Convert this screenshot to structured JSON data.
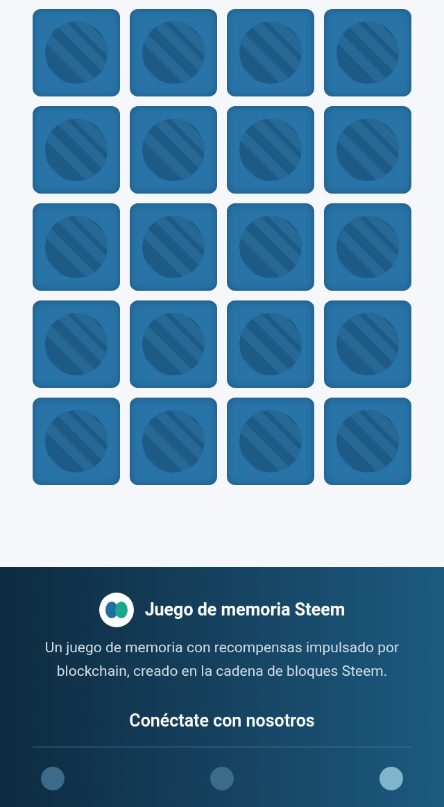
{
  "cards": [
    {
      "flipped": false
    },
    {
      "flipped": false
    },
    {
      "flipped": false
    },
    {
      "flipped": false
    },
    {
      "flipped": false
    },
    {
      "flipped": false
    },
    {
      "flipped": false
    },
    {
      "flipped": false
    },
    {
      "flipped": false
    },
    {
      "flipped": false
    },
    {
      "flipped": false
    },
    {
      "flipped": false
    },
    {
      "flipped": false
    },
    {
      "flipped": false
    },
    {
      "flipped": false
    },
    {
      "flipped": false
    },
    {
      "flipped": false
    },
    {
      "flipped": false
    },
    {
      "flipped": false
    },
    {
      "flipped": false
    }
  ],
  "footer": {
    "title": "Juego de memoria Steem",
    "description": "Un juego de memoria con recompensas impulsado por blockchain, creado en la cadena de bloques Steem.",
    "connect_heading": "Conéctate con nosotros"
  }
}
